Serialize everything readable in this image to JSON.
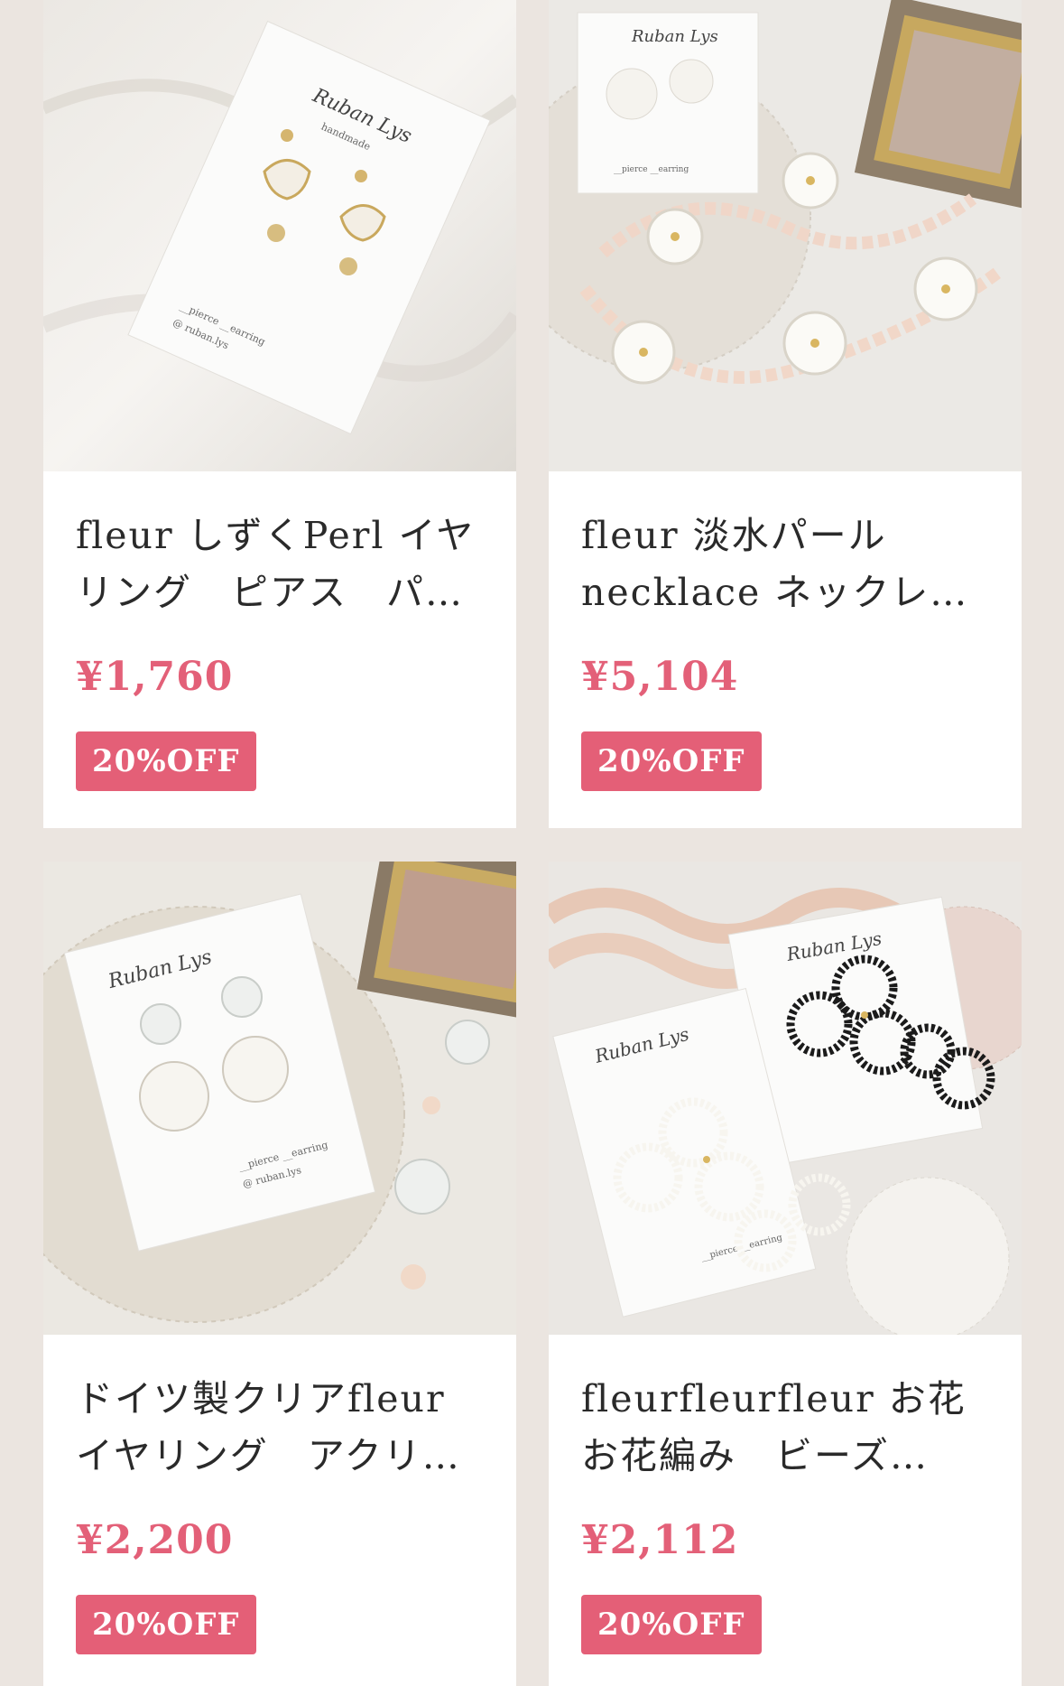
{
  "products": [
    {
      "title": "fleur しずくPerl イヤリング　ピアス　パ…",
      "price": "¥1,760",
      "discount": "20%OFF"
    },
    {
      "title": "fleur 淡水パールnecklace ネックレス　淡…",
      "price": "¥5,104",
      "discount": "20%OFF"
    },
    {
      "title": "ドイツ製クリアfleur イヤリング　アクリ…",
      "price": "¥2,200",
      "discount": "20%OFF"
    },
    {
      "title": "fleurfleurfleur お花　お花編み　ビーズ…",
      "price": "¥2,112",
      "discount": "20%OFF"
    }
  ],
  "colors": {
    "accent": "#e45f77",
    "price": "#e36078",
    "background": "#ebe5e0"
  }
}
